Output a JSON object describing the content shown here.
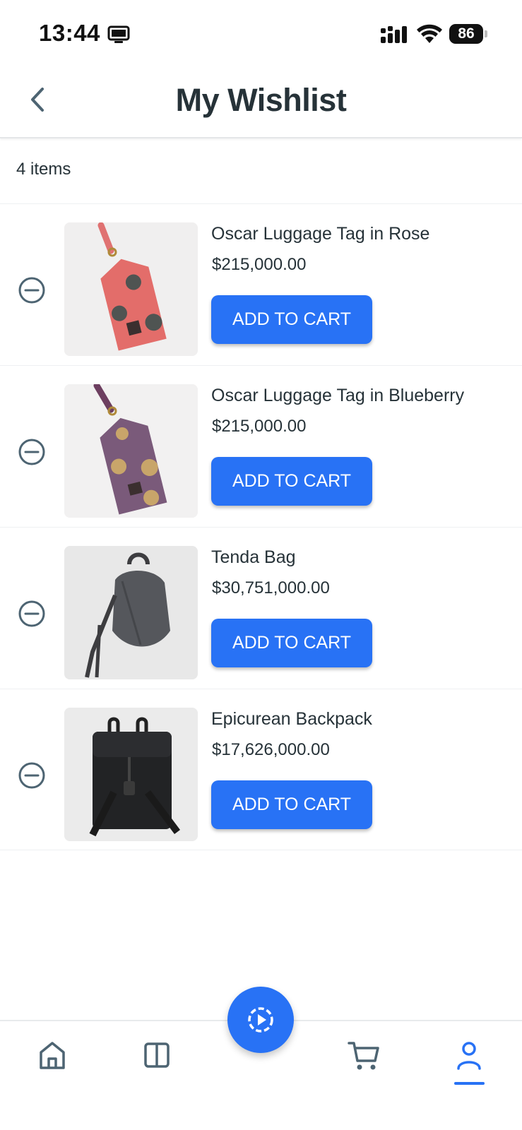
{
  "status_bar": {
    "time": "13:44",
    "battery": "86",
    "icons": [
      "screen-icon",
      "signal-icon",
      "wifi-icon",
      "battery-icon"
    ]
  },
  "header": {
    "title": "My Wishlist",
    "back_icon": "chevron-left-icon"
  },
  "item_count": "4 items",
  "items": [
    {
      "name": "Oscar Luggage Tag in Rose",
      "price": "$215,000.00",
      "button": "ADD TO CART",
      "image": "pink-luggage-tag-with-dots"
    },
    {
      "name": "Oscar Luggage Tag in Blueberry",
      "price": "$215,000.00",
      "button": "ADD TO CART",
      "image": "purple-luggage-tag-with-dots"
    },
    {
      "name": "Tenda Bag",
      "price": "$30,751,000.00",
      "button": "ADD TO CART",
      "image": "grey-leather-bag"
    },
    {
      "name": "Epicurean Backpack",
      "price": "$17,626,000.00",
      "button": "ADD TO CART",
      "image": "black-backpack"
    }
  ],
  "bottom_nav": {
    "items": [
      "home-icon",
      "catalog-icon",
      "play-icon",
      "cart-icon",
      "account-icon"
    ],
    "active": "account-icon"
  },
  "colors": {
    "accent": "#2872f5",
    "text": "#263238",
    "icon": "#4d6472"
  }
}
